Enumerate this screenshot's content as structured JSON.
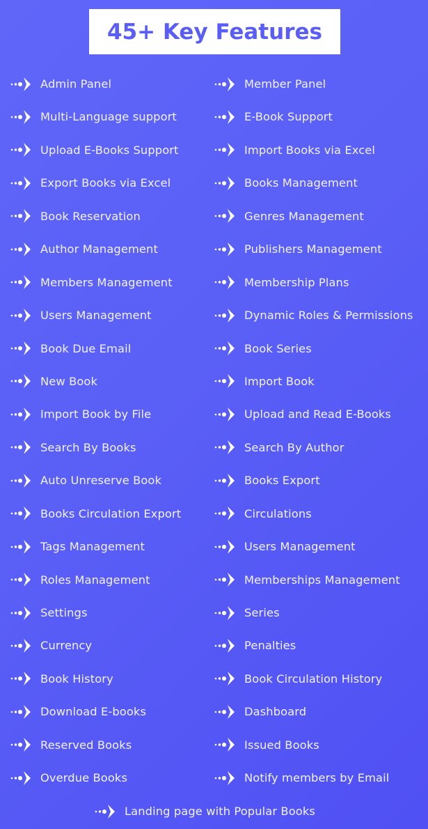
{
  "header": {
    "title": "45+ Key Features"
  },
  "colors": {
    "background_start": "#5f66f8",
    "background_end": "#5050f4",
    "title_box": "#ffffff",
    "title_text": "#5a5ef4",
    "item_text": "#f2f2ff"
  },
  "bullet_icon": "dotted-arrow-icon",
  "features": {
    "left": [
      "Admin Panel",
      "Multi-Language support",
      "Upload E-Books Support",
      "Export Books via Excel",
      "Book Reservation",
      "Author Management",
      "Members Management",
      "Users Management",
      "Book Due Email",
      "New Book",
      "Import Book by File",
      "Search By Books",
      "Auto Unreserve Book",
      "Books Circulation Export",
      "Tags Management",
      "Roles Management",
      "Settings",
      "Currency",
      "Book History",
      "Download E-books",
      "Reserved Books",
      "Overdue Books"
    ],
    "right": [
      "Member Panel",
      "E-Book Support",
      "Import Books via Excel",
      "Books Management",
      "Genres Management",
      "Publishers Management",
      "Membership Plans",
      "Dynamic Roles & Permissions",
      "Book Series",
      "Import Book",
      "Upload and Read E-Books",
      "Search By Author",
      "Books Export",
      "Circulations",
      "Users Management",
      "Memberships Management",
      "Series",
      "Penalties",
      "Book Circulation History",
      "Dashboard",
      "Issued Books",
      "Notify members by Email"
    ],
    "footer": "Landing page with Popular Books"
  }
}
